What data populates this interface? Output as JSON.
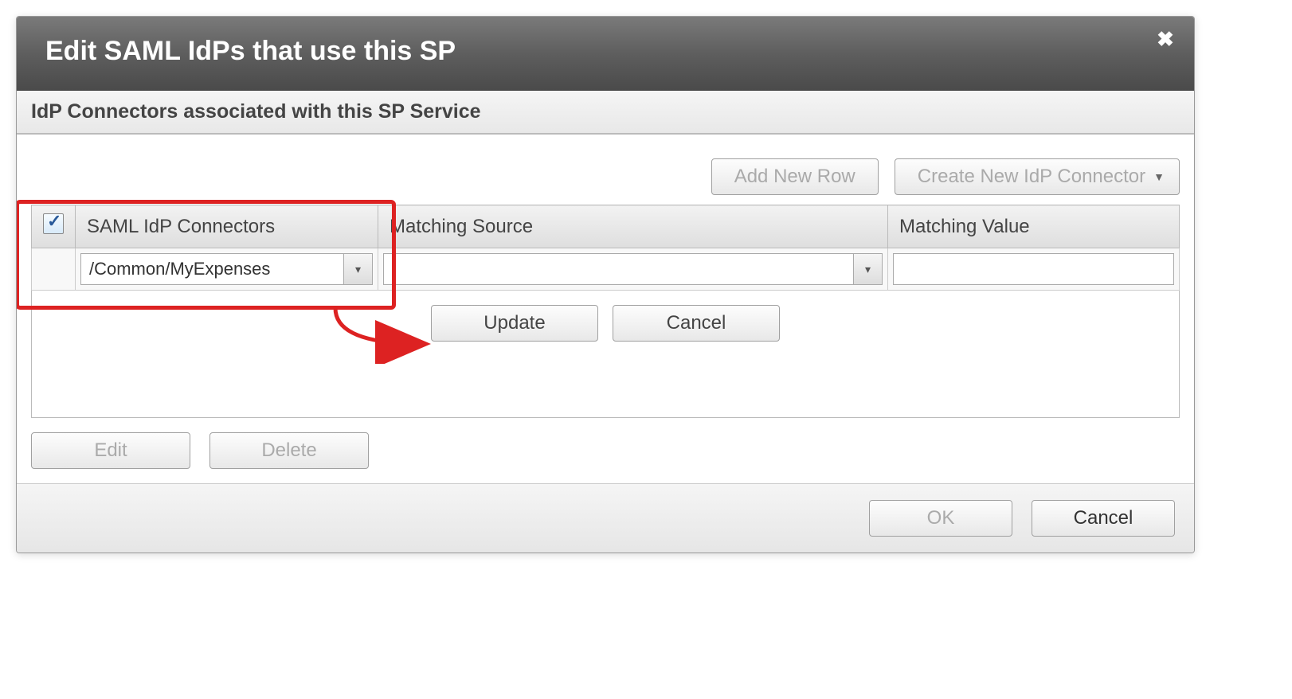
{
  "dialog": {
    "title": "Edit SAML IdPs that use this SP"
  },
  "section": {
    "title": "IdP Connectors associated with this SP Service"
  },
  "toolbar": {
    "addRow": "Add New Row",
    "createConnector": "Create New IdP Connector"
  },
  "table": {
    "headers": {
      "connectors": "SAML IdP Connectors",
      "source": "Matching Source",
      "value": "Matching Value"
    },
    "row": {
      "checked": true,
      "connectorValue": "/Common/MyExpenses",
      "sourceValue": "",
      "matchValue": ""
    }
  },
  "rowActions": {
    "update": "Update",
    "cancel": "Cancel"
  },
  "bottomActions": {
    "edit": "Edit",
    "delete": "Delete"
  },
  "footer": {
    "ok": "OK",
    "cancel": "Cancel"
  }
}
